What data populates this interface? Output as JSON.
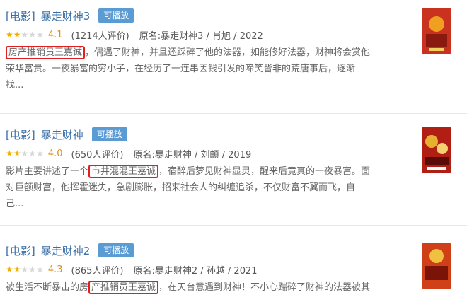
{
  "results": [
    {
      "category": "[电影]",
      "title": "暴走财神3",
      "badge": "可播放",
      "stars": {
        "filled": 2,
        "total": 5
      },
      "score": "4.1",
      "votes": "(1214人评价)",
      "meta": "原名:暴走财神3 / 肖旭 / 2022",
      "desc_line1_pre": "",
      "desc_highlight": "房产推销员王嘉诚",
      "desc_line1_post": "，偶遇了财神，并且还踩碎了他的法器，如能修好法器，财神将会赏他",
      "desc_line2": "荣华富贵。一夜暴富的穷小子，在经历了一连串因钱引发的啼笑皆非的荒唐事后，逐渐",
      "desc_line3": "找...",
      "poster_colors": [
        "#c8321e",
        "#f0a020",
        "#8a1a10"
      ]
    },
    {
      "category": "[电影]",
      "title": "暴走财神",
      "badge": "可播放",
      "stars": {
        "filled": 2,
        "total": 5
      },
      "score": "4.0",
      "votes": "(650人评价)",
      "meta": "原名:暴走财神 / 刘頔 / 2019",
      "desc_line1_pre": "影片主要讲述了一个",
      "desc_highlight": "市井混混王嘉诚",
      "desc_line1_post": "，宿醉后梦见财神显灵，醒来后竟真的一夜暴富。面",
      "desc_line2": "对巨额财富，他挥霍迷失，急剧膨胀，招来社会人的纠缠追杀，不仅财富不翼而飞，自",
      "desc_line3": "己...",
      "poster_colors": [
        "#b01e14",
        "#e8b030",
        "#5a0c08"
      ]
    },
    {
      "category": "[电影]",
      "title": "暴走财神2",
      "badge": "可播放",
      "stars": {
        "filled": 2,
        "total": 5
      },
      "score": "4.3",
      "votes": "(865人评价)",
      "meta": "原名:暴走财神2 / 孙越 / 2021",
      "desc_line1_pre": "被生活不断暴击的房",
      "desc_highlight": "产推销员王嘉诚",
      "desc_line1_post": "，在天台意遇到财神！不小心踹碎了财神的法器被其",
      "desc_line2": "",
      "desc_line3": "",
      "poster_colors": [
        "#d04018",
        "#f2c040",
        "#7a1408"
      ]
    }
  ]
}
